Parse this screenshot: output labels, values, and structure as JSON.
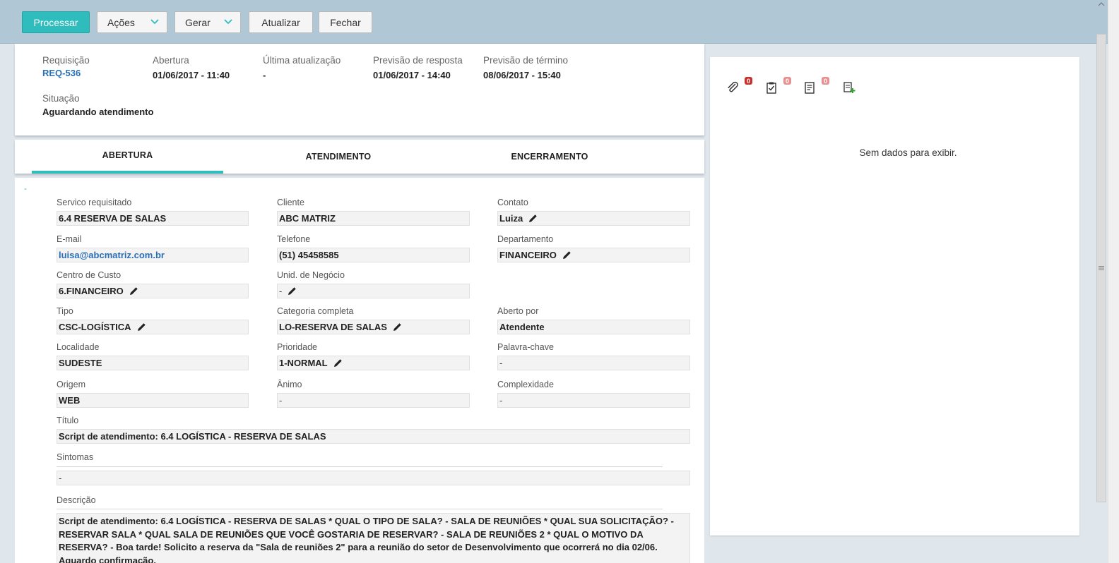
{
  "toolbar": {
    "process": "Processar",
    "actions": "Ações",
    "generate": "Gerar",
    "refresh": "Atualizar",
    "close": "Fechar"
  },
  "summary": {
    "request_label": "Requisição",
    "request_value": "REQ-536",
    "opening_label": "Abertura",
    "opening_value": "01/06/2017 - 11:40",
    "last_update_label": "Última atualização",
    "last_update_value": "-",
    "response_forecast_label": "Previsão de resposta",
    "response_forecast_value": "01/06/2017 - 14:40",
    "end_forecast_label": "Previsão de término",
    "end_forecast_value": "08/06/2017 - 15:40",
    "status_label": "Situação",
    "status_value": "Aguardando atendimento"
  },
  "tabs": [
    "ABERTURA",
    "ATENDIMENTO",
    "ENCERRAMENTO"
  ],
  "form": {
    "collapse": "-",
    "service_label": "Servico requisitado",
    "service_value": "6.4 RESERVA DE SALAS",
    "client_label": "Cliente",
    "client_value": "ABC MATRIZ",
    "contact_label": "Contato",
    "contact_value": "Luiza",
    "email_label": "E-mail",
    "email_value": "luisa@abcmatriz.com.br",
    "phone_label": "Telefone",
    "phone_value": "(51) 45458585",
    "department_label": "Departamento",
    "department_value": "FINANCEIRO",
    "cost_center_label": "Centro de Custo",
    "cost_center_value": "6.FINANCEIRO",
    "business_unit_label": "Unid. de Negócio",
    "business_unit_value": "-",
    "type_label": "Tipo",
    "type_value": "CSC-LOGÍSTICA",
    "category_label": "Categoria completa",
    "category_value": "LO-RESERVA DE SALAS",
    "opened_by_label": "Aberto por",
    "opened_by_value": "Atendente",
    "location_label": "Localidade",
    "location_value": "SUDESTE",
    "priority_label": "Prioridade",
    "priority_value": "1-NORMAL",
    "keyword_label": "Palavra-chave",
    "keyword_value": "-",
    "origin_label": "Origem",
    "origin_value": "WEB",
    "mood_label": "Ânimo",
    "mood_value": "-",
    "complexity_label": "Complexidade",
    "complexity_value": "-",
    "title_label": "Título",
    "title_value": "Script de atendimento: 6.4 LOGÍSTICA - RESERVA DE SALAS",
    "symptoms_label": "Sintomas",
    "symptoms_value": "-",
    "description_label": "Descrição",
    "description_value": "Script de atendimento: 6.4 LOGÍSTICA - RESERVA DE SALAS * QUAL O TIPO DE SALA? - SALA DE REUNIÕES * QUAL SUA SOLICITAÇÃO? - RESERVAR SALA * QUAL SALA DE REUNIÕES QUE VOCÊ GOSTARIA DE RESERVAR? - SALA DE REUNIÕES 2 * QUAL O MOTIVO DA RESERVA? - Boa tarde! Solicito a reserva da \"Sala de reuniões 2\" para a reunião do setor de Desenvolvimento que ocorrerá no dia 02/06. Aguardo confirmação."
  },
  "right_panel": {
    "attachments_count": "0",
    "tasks_count": "0",
    "notes_count": "0",
    "empty_message": "Sem dados para exibir."
  },
  "colors": {
    "accent": "#2fbcbc",
    "toolbar_bg": "#b0c8d6",
    "link": "#2a6fb5",
    "badge": "#c8302c"
  }
}
